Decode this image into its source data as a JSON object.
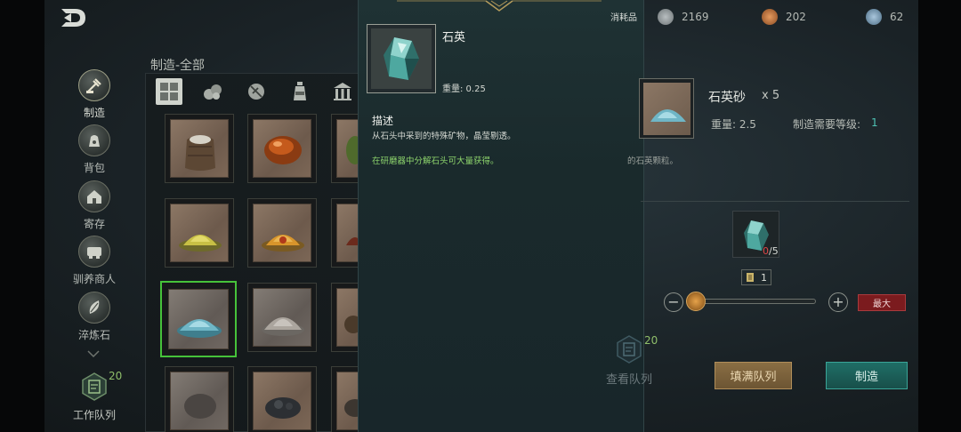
{
  "back": {
    "icon": "back-arrow-icon"
  },
  "resources": [
    {
      "name": "silver-coin-icon",
      "value": "2169",
      "color": "#8e9597"
    },
    {
      "name": "copper-coin-icon",
      "value": "202",
      "color": "#b46a3b"
    },
    {
      "name": "blue-gem-icon",
      "value": "62",
      "color": "#6e8fa8"
    }
  ],
  "sidebar": {
    "items": [
      {
        "label": "制造",
        "icon": "crafting-icon"
      },
      {
        "label": "背包",
        "icon": "bag-icon"
      },
      {
        "label": "寄存",
        "icon": "storage-icon"
      },
      {
        "label": "驯养商人",
        "icon": "merchant-icon"
      },
      {
        "label": "淬炼石",
        "icon": "refine-stone-icon"
      }
    ],
    "work_queue": {
      "label": "工作队列",
      "count": "20"
    }
  },
  "panel": {
    "title": "制造-全部"
  },
  "popup": {
    "type_label": "消耗品",
    "item_name": "石英",
    "weight": "重量: 0.25",
    "desc_title": "描述",
    "desc_text": "从石头中采到的特殊矿物，晶莹剔透。",
    "desc_green": "在研磨器中分解石头可大量获得。"
  },
  "product": {
    "name": "石英砂",
    "qty": "x 5",
    "weight": "重量: 2.5",
    "level_label": "制造需要等级:",
    "level_value": "1",
    "desc_tail": "的石英颗粒。"
  },
  "material": {
    "have": "0",
    "need": "/5"
  },
  "amount": {
    "value": "1",
    "max_label": "最大",
    "minus": "−",
    "plus": "+",
    "slider_fraction": 0.05
  },
  "view_queue": {
    "label": "查看队列",
    "count": "20"
  },
  "buttons": {
    "fill": "填满队列",
    "craft": "制造"
  },
  "colors": {
    "selected_border": "#46c23a",
    "level": "#4ec2b3",
    "green_text": "#8dd46c"
  }
}
